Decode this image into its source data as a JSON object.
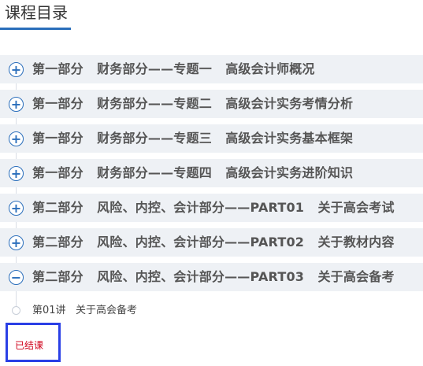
{
  "header": {
    "title": "课程目录"
  },
  "chapters": [
    {
      "label": "第一部分   财务部分——专题一   高级会计师概况",
      "icon": "plus-circle-icon"
    },
    {
      "label": "第一部分   财务部分——专题二   高级会计实务考情分析",
      "icon": "plus-circle-icon"
    },
    {
      "label": "第一部分   财务部分——专题三   高级会计实务基本框架",
      "icon": "plus-circle-icon"
    },
    {
      "label": "第一部分   财务部分——专题四   高级会计实务进阶知识",
      "icon": "plus-circle-icon"
    },
    {
      "label": "第二部分   风险、内控、会计部分——PART01   关于高会考试",
      "icon": "plus-circle-icon"
    },
    {
      "label": "第二部分   风险、内控、会计部分——PART02   关于教材内容",
      "icon": "plus-circle-icon"
    },
    {
      "label": "第二部分   风险、内控、会计部分——PART03   关于高会备考",
      "icon": "minus-circle-icon"
    }
  ],
  "toggle_glyphs": {
    "plus": "+",
    "minus": "−"
  },
  "lesson": {
    "title": "第01讲   关于高会备考",
    "status": "已结课"
  },
  "colors": {
    "accent": "#2a6ebb",
    "status": "#d0021b",
    "highlight_box": "#2a3fe6"
  }
}
